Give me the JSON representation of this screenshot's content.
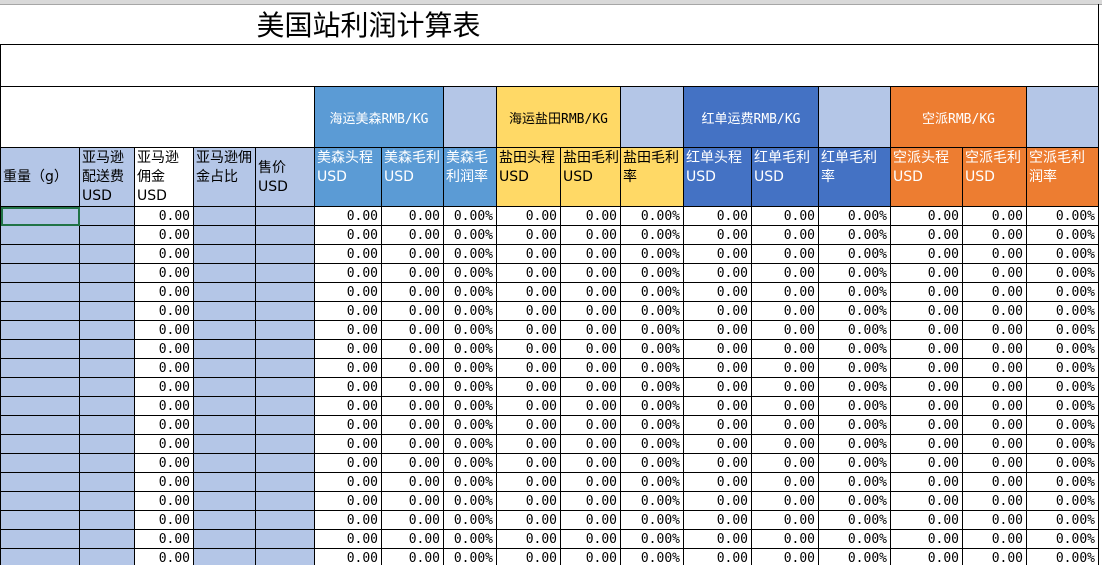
{
  "title": "美国站利润计算表",
  "groups": [
    {
      "label": "海运美森RMB/KG",
      "color": "#5b9bd5"
    },
    {
      "label": "海运盐田RMB/KG",
      "color": "#ffd966"
    },
    {
      "label": "红单运费RMB/KG",
      "color": "#4472c4"
    },
    {
      "label": "空派RMB/KG",
      "color": "#ed7d31"
    }
  ],
  "headers": [
    "重量（g）",
    "亚马逊配送费USD",
    "亚马逊佣金USD",
    "亚马逊佣金占比",
    "售价USD",
    "美森头程USD",
    "美森毛利USD",
    "美森毛利润率",
    "盐田头程USD",
    "盐田毛利USD",
    "盐田毛利率",
    "红单头程USD",
    "红单毛利USD",
    "红单毛利率",
    "空派头程USD",
    "空派毛利USD",
    "空派毛利润率"
  ],
  "cell_values": {
    "amount": "0.00",
    "percent": "0.00%"
  }
}
